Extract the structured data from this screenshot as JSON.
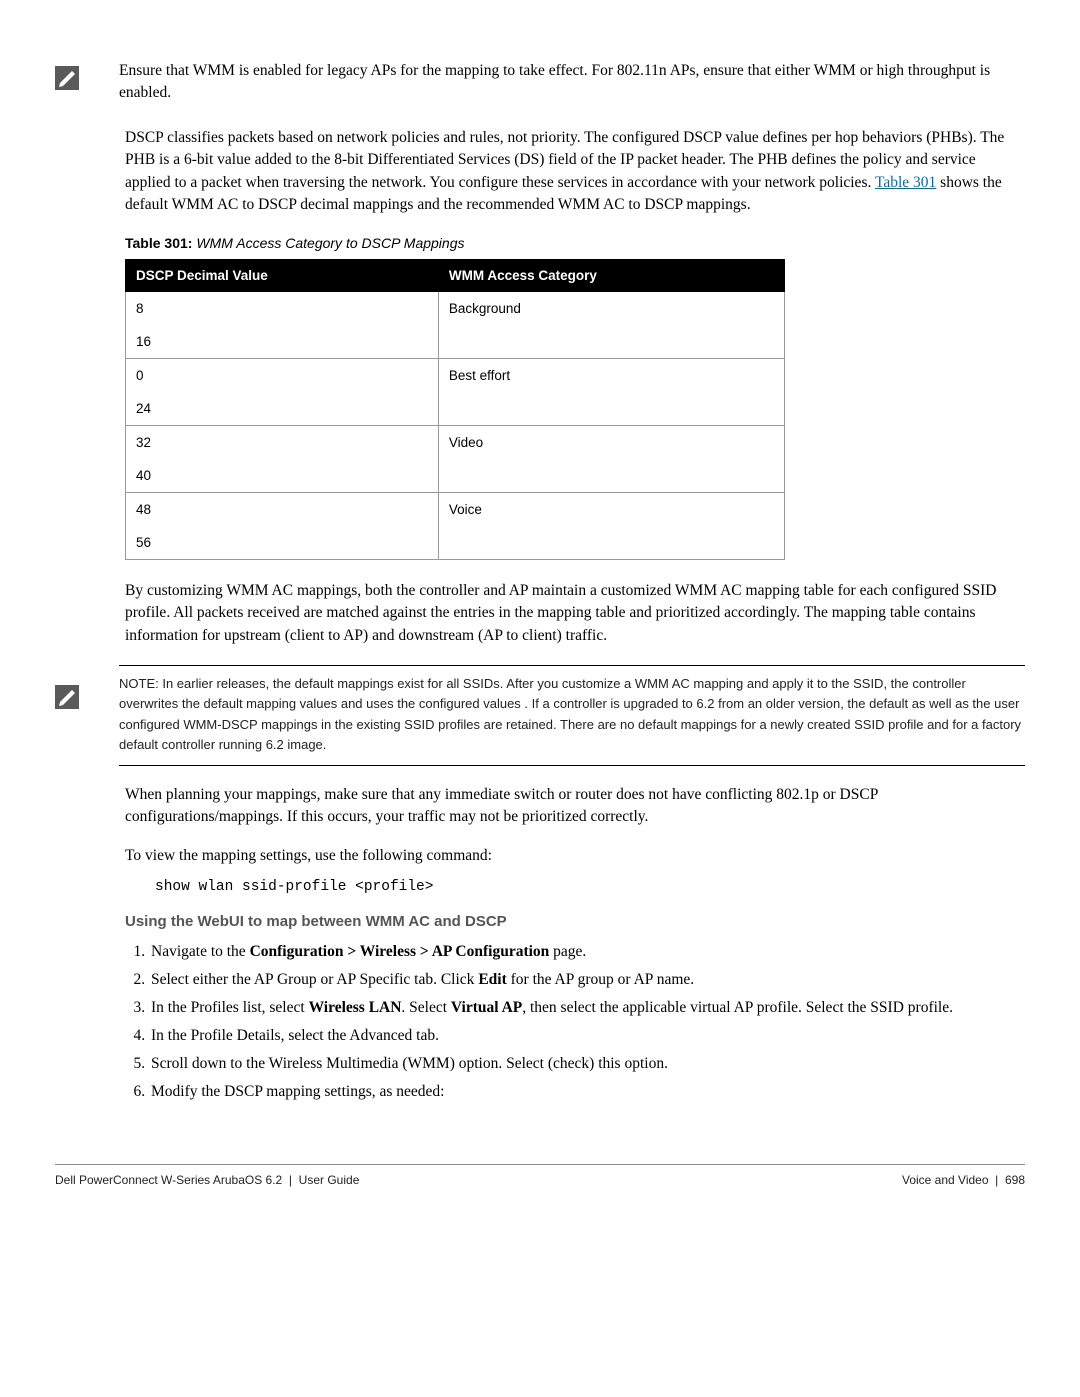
{
  "note1": "Ensure that WMM is enabled for legacy APs for the mapping to take effect. For 802.11n APs, ensure that either WMM or high throughput is enabled.",
  "para1_pre": "DSCP classifies packets based on network policies and rules, not priority. The configured DSCP value defines per hop behaviors (PHBs). The PHB is a 6-bit value added to the 8-bit Differentiated Services (DS) field of the IP packet header. The PHB defines the policy and service applied to a packet when traversing the network. You configure these services in accordance with your network policies. ",
  "para1_link": "Table 301",
  "para1_post": " shows the default WMM AC to DSCP decimal mappings and the recommended WMM AC to DSCP mappings.",
  "table": {
    "label_bold": "Table 301:",
    "label_ital": " WMM Access Category to DSCP Mappings",
    "h1": "DSCP Decimal Value",
    "h2": "WMM Access Category",
    "rows": [
      {
        "dscp": "8",
        "cat": "Background"
      },
      {
        "dscp": "16",
        "cat": ""
      },
      {
        "dscp": "0",
        "cat": "Best effort"
      },
      {
        "dscp": "24",
        "cat": ""
      },
      {
        "dscp": "32",
        "cat": "Video"
      },
      {
        "dscp": "40",
        "cat": ""
      },
      {
        "dscp": "48",
        "cat": "Voice"
      },
      {
        "dscp": "56",
        "cat": ""
      }
    ]
  },
  "para2": "By customizing WMM AC mappings, both the controller and AP maintain a customized WMM AC mapping table for each configured SSID profile. All packets received are matched against the entries in the mapping table and prioritized accordingly. The mapping table contains information for upstream (client to AP) and downstream (AP to client) traffic.",
  "note2": "NOTE: In earlier releases, the default mappings exist for all SSIDs. After you customize a WMM AC mapping and apply it to the SSID, the controller overwrites the default mapping values and uses the configured values . If a controller is upgraded to 6.2 from an older version, the default as well as the user configured WMM-DSCP mappings in the existing SSID profiles are retained. There are no default mappings for a newly created SSID profile and for a factory default controller running 6.2 image.",
  "para3": "When planning your mappings, make sure that any immediate switch or router does not have conflicting 802.1p or DSCP configurations/mappings. If this occurs, your traffic may not be prioritized correctly.",
  "para4": "To view the mapping settings, use the following command:",
  "code": "show wlan ssid-profile <profile>",
  "section_h": "Using the WebUI to map between WMM AC and DSCP",
  "steps": {
    "s1_pre": "Navigate to the ",
    "s1_bold": "Configuration > Wireless > AP Configuration",
    "s1_post": " page.",
    "s2_pre": "Select either the AP Group or AP Specific tab. Click ",
    "s2_bold": "Edit",
    "s2_post": " for the AP group or AP name.",
    "s3_pre": "In the Profiles list, select ",
    "s3_bold1": "Wireless LAN",
    "s3_mid": ". Select ",
    "s3_bold2": "Virtual AP",
    "s3_post": ", then select the applicable virtual AP profile. Select the SSID profile.",
    "s4": "In the Profile Details, select the Advanced tab.",
    "s5": "Scroll down to the Wireless Multimedia (WMM) option. Select (check) this option.",
    "s6": "Modify the DSCP mapping settings, as needed:"
  },
  "footer": {
    "left": "Dell PowerConnect W-Series ArubaOS 6.2",
    "left2": "User Guide",
    "right_label": "Voice and Video",
    "right_page": "698"
  }
}
